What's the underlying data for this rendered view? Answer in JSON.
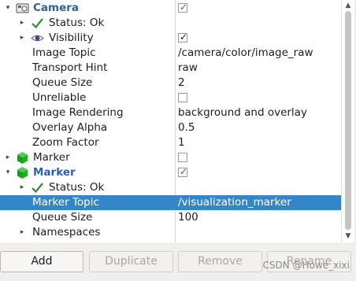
{
  "tree": {
    "camera": {
      "label": "Camera",
      "checked": true
    },
    "camera_status": {
      "label": "Status: Ok"
    },
    "visibility": {
      "label": "Visibility",
      "checked": true
    },
    "image_topic": {
      "label": "Image Topic",
      "value": "/camera/color/image_raw"
    },
    "transport_hint": {
      "label": "Transport Hint",
      "value": "raw"
    },
    "queue_size": {
      "label": "Queue Size",
      "value": "2"
    },
    "unreliable": {
      "label": "Unreliable",
      "checked": false
    },
    "image_rendering": {
      "label": "Image Rendering",
      "value": "background and overlay"
    },
    "overlay_alpha": {
      "label": "Overlay Alpha",
      "value": "0.5"
    },
    "zoom_factor": {
      "label": "Zoom Factor",
      "value": "1"
    },
    "marker1": {
      "label": "Marker",
      "checked": false
    },
    "marker2": {
      "label": "Marker",
      "checked": true
    },
    "marker_status": {
      "label": "Status: Ok"
    },
    "marker_topic": {
      "label": "Marker Topic",
      "value": "/visualization_marker"
    },
    "marker_queue": {
      "label": "Queue Size",
      "value": "100"
    },
    "namespaces": {
      "label": "Namespaces"
    }
  },
  "buttons": {
    "add": "Add",
    "duplicate": "Duplicate",
    "remove": "Remove",
    "rename": "Rename"
  },
  "watermark": "CSDN @Howe_xixi",
  "icons": {
    "camera": "camera-icon",
    "eye": "eye-icon",
    "status": "checkmark-icon",
    "marker": "green-cube-icon"
  },
  "colors": {
    "selection": "#3286c9",
    "heading": "#2a62a8",
    "status_green": "#2e8b2e",
    "cube_green": "#22b022"
  }
}
